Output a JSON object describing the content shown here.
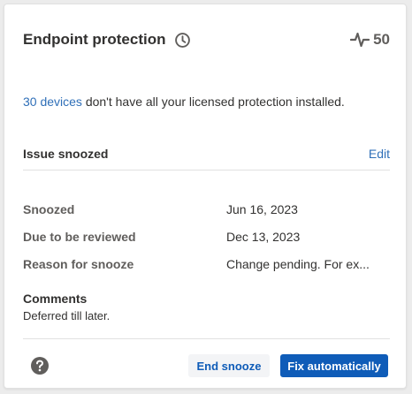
{
  "card": {
    "title": "Endpoint protection",
    "score": "50",
    "icons": {
      "clock": "clock-icon",
      "score": "pulse-icon",
      "help": "help-icon"
    }
  },
  "message": {
    "link_text": "30 devices",
    "text": " don't have all your licensed protection installed."
  },
  "status": {
    "title": "Issue snoozed",
    "edit_label": "Edit"
  },
  "details": [
    {
      "label": "Snoozed",
      "value": "Jun 16, 2023"
    },
    {
      "label": "Due to be reviewed",
      "value": "Dec 13, 2023"
    },
    {
      "label": "Reason for snooze",
      "value": "Change pending. For ex..."
    }
  ],
  "comments": {
    "title": "Comments",
    "text": "Deferred till later."
  },
  "actions": {
    "end_snooze_label": "End snooze",
    "fix_label": "Fix automatically"
  },
  "colors": {
    "link": "#2f6fb8",
    "primary": "#0f5cb8",
    "text": "#323130",
    "muted": "#605e5c"
  }
}
